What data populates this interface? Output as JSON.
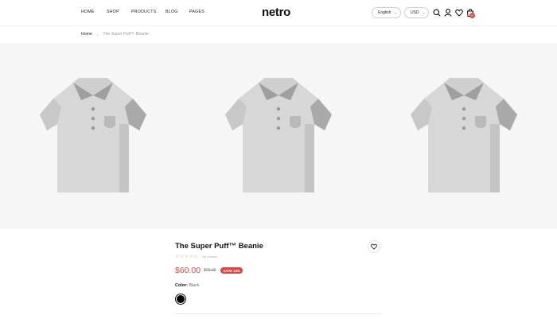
{
  "header": {
    "nav": [
      "HOME",
      "SHOP",
      "PRODUCTS",
      "BLOG",
      "PAGES"
    ],
    "logo": "netro",
    "language": "English",
    "currency": "USD",
    "cart_count": "0",
    "icons": [
      "search-icon",
      "user-icon",
      "heart-icon",
      "cart-icon"
    ]
  },
  "breadcrumb": {
    "home": "Home",
    "current": "The Super Puff™ Beanie"
  },
  "gallery": {
    "images": [
      "shirt-image",
      "shirt-image",
      "shirt-image"
    ]
  },
  "product": {
    "title": "The Super Puff™ Beanie",
    "stars": "☆☆☆☆☆",
    "reviews": "No reviews",
    "price": "$60.00",
    "old_price": "$70.00",
    "save_badge": "SAVE 14%",
    "color_label": "Color:",
    "color_value": "Black"
  },
  "colors": {
    "accent": "#e0443e",
    "stars": "#e0a64a",
    "gallery_bg": "#f6f6f6"
  }
}
